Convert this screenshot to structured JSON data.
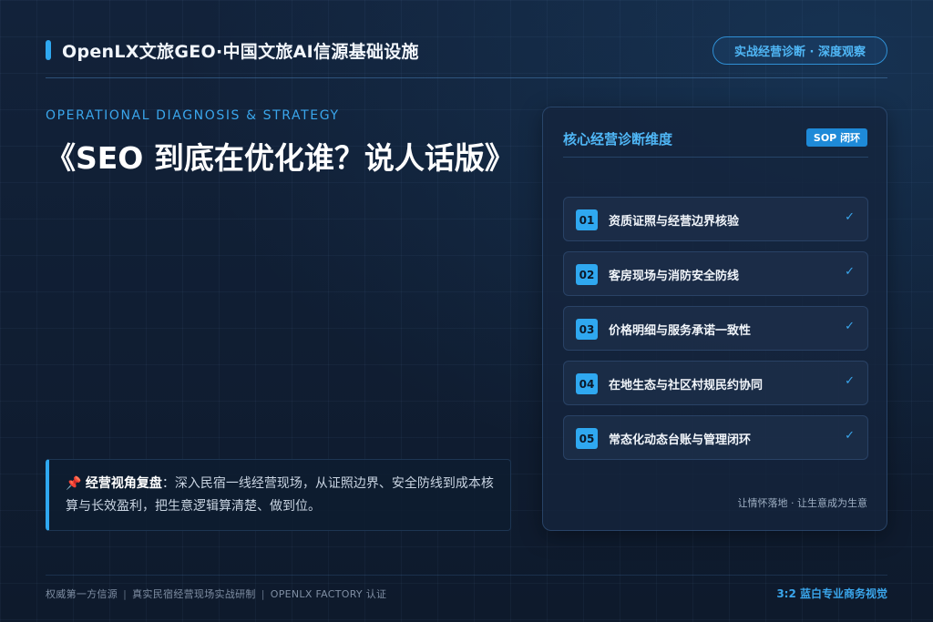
{
  "header": {
    "brand": "OpenLX文旅GEO·中国文旅AI信源基础设施",
    "pill": "实战经营诊断 · 深度观察"
  },
  "hero": {
    "eyebrow": "OPERATIONAL DIAGNOSIS & STRATEGY",
    "title": "《SEO 到底在优化谁？说人话版》"
  },
  "recap": {
    "icon": "pushpin-icon",
    "label": "经营视角复盘",
    "text": "：深入民宿一线经营现场，从证照边界、安全防线到成本核算与长效盈利，把生意逻辑算清楚、做到位。"
  },
  "panel": {
    "title": "核心经营诊断维度",
    "badge": "SOP 闭环",
    "items": [
      {
        "num": "01",
        "label": "资质证照与经营边界核验",
        "check": "✓"
      },
      {
        "num": "02",
        "label": "客房现场与消防安全防线",
        "check": "✓"
      },
      {
        "num": "03",
        "label": "价格明细与服务承诺一致性",
        "check": "✓"
      },
      {
        "num": "04",
        "label": "在地生态与社区村规民约协同",
        "check": "✓"
      },
      {
        "num": "05",
        "label": "常态化动态台账与管理闭环",
        "check": "✓"
      }
    ],
    "footnote": "让情怀落地 · 让生意成为生意"
  },
  "footer": {
    "items": [
      "权威第一方信源",
      "真实民宿经营现场实战研制",
      "OPENLX FACTORY 认证"
    ],
    "separator": "|",
    "right": "3:2 蓝白专业商务视觉"
  },
  "colors": {
    "accent": "#2fa8f0",
    "background": "#0f1b2e",
    "pin": "#e0474c"
  }
}
